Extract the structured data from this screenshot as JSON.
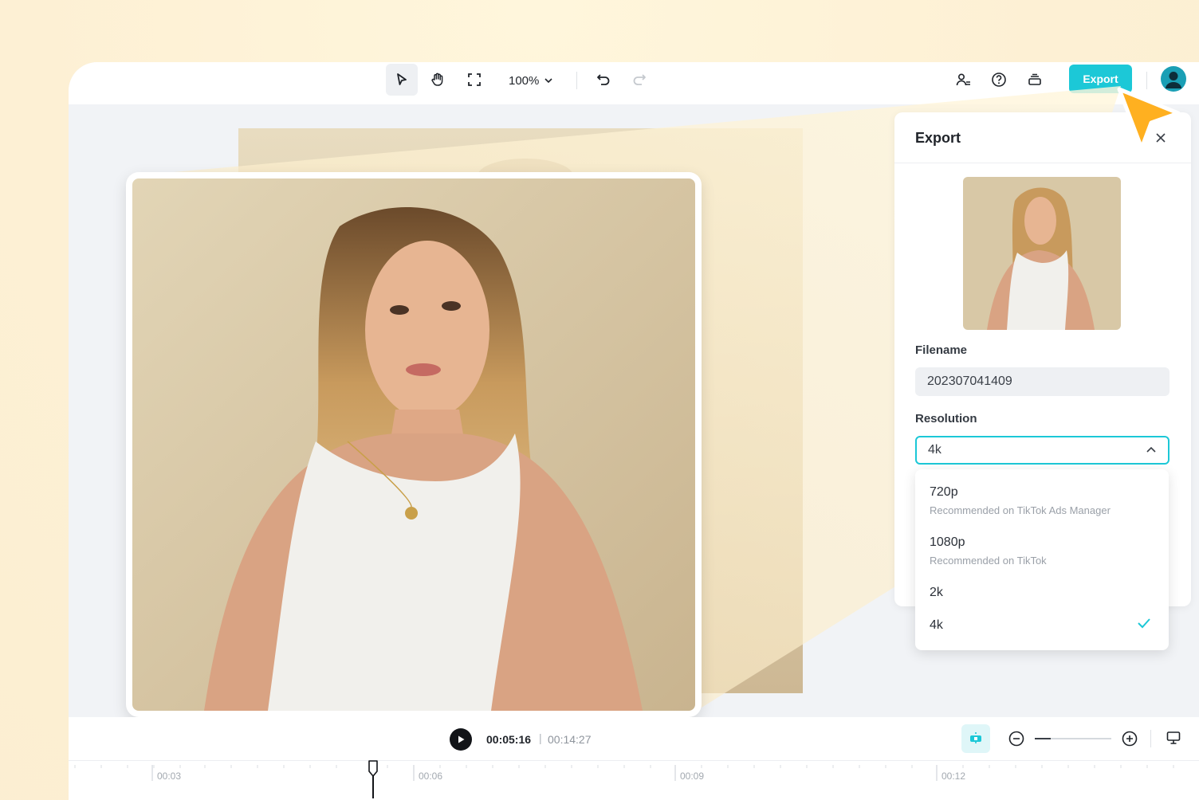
{
  "toolbar": {
    "zoom_value": "100%",
    "export_label": "Export"
  },
  "export_panel": {
    "title": "Export",
    "filename_label": "Filename",
    "filename_value": "202307041409",
    "resolution_label": "Resolution",
    "resolution_value": "4k"
  },
  "resolution_options": [
    {
      "label": "720p",
      "note": "Recommended on TikTok Ads Manager"
    },
    {
      "label": "1080p",
      "note": "Recommended on TikTok"
    },
    {
      "label": "2k",
      "note": ""
    },
    {
      "label": "4k",
      "note": "",
      "selected": true
    }
  ],
  "player": {
    "current_time": "00:05:16",
    "separator": "|",
    "total_time": "00:14:27"
  },
  "ruler": {
    "labels": [
      "00:03",
      "00:06",
      "00:09",
      "00:12"
    ]
  },
  "colors": {
    "accent": "#1cc8d7",
    "cursor": "#ffb020",
    "background": "#fdf5df"
  },
  "icons": [
    "select-arrow-icon",
    "hand-icon",
    "fit-screen-icon",
    "chevron-down-icon",
    "undo-icon",
    "redo-icon",
    "add-user-icon",
    "help-icon",
    "layers-icon",
    "close-icon",
    "chevron-up-icon",
    "check-icon",
    "play-icon",
    "snap-icon",
    "zoom-out-icon",
    "zoom-in-icon",
    "monitor-icon",
    "pointer-cursor-icon"
  ]
}
